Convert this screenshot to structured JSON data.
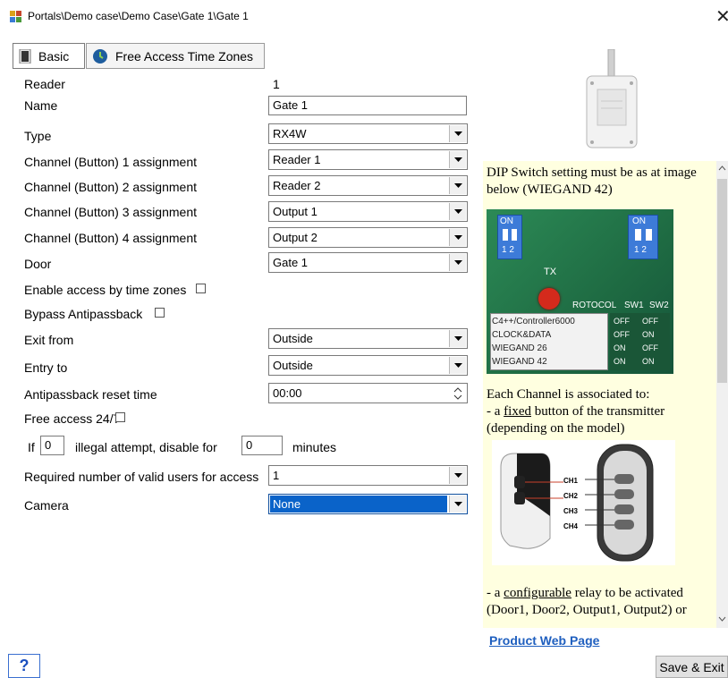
{
  "window": {
    "title": "Portals\\Demo case\\Demo Case\\Gate 1\\Gate 1",
    "close_glyph": "✕"
  },
  "tabs": [
    {
      "label": "Basic",
      "icon": "device-icon"
    },
    {
      "label": "Free Access Time Zones",
      "icon": "clock-icon"
    }
  ],
  "form": {
    "reader": {
      "label": "Reader",
      "value": "1"
    },
    "name": {
      "label": "Name",
      "value": "Gate 1"
    },
    "type": {
      "label": "Type",
      "value": "RX4W"
    },
    "ch1": {
      "label": "Channel (Button) 1 assignment",
      "value": "Reader 1"
    },
    "ch2": {
      "label": "Channel (Button) 2 assignment",
      "value": "Reader 2"
    },
    "ch3": {
      "label": "Channel (Button) 3 assignment",
      "value": "Output 1"
    },
    "ch4": {
      "label": "Channel (Button) 4 assignment",
      "value": "Output 2"
    },
    "door": {
      "label": "Door",
      "value": "Gate 1"
    },
    "enable_tz": {
      "label": "Enable access by time zones",
      "checked": false
    },
    "bypass": {
      "label": "Bypass Antipassback",
      "checked": false
    },
    "exit_from": {
      "label": "Exit from",
      "value": "Outside"
    },
    "entry_to": {
      "label": "Entry to",
      "value": "Outside"
    },
    "apb_reset": {
      "label": "Antipassback reset time",
      "value": "00:00"
    },
    "free_access": {
      "label": "Free access 24/7",
      "checked": false
    },
    "illegal": {
      "prefix": "If",
      "attempts": "0",
      "middle": "illegal attempt, disable for",
      "minutes": "0",
      "suffix": "minutes"
    },
    "required_users": {
      "label": "Required number of valid users for access",
      "value": "1"
    },
    "camera": {
      "label": "Camera",
      "value": "None"
    }
  },
  "info": {
    "dip_text": "DIP Switch setting must be as at image below (WIEGAND 42)",
    "dip_board": {
      "on1": "ON",
      "nums1": "1 2",
      "on2": "ON",
      "nums2": "1 2",
      "tx": "TX",
      "protocol": "ROTOCOL",
      "sw1": "SW1",
      "sw2": "SW2",
      "rows": [
        {
          "name": "C4++/Controller6000",
          "sw1": "OFF",
          "sw2": "OFF"
        },
        {
          "name": "CLOCK&DATA",
          "sw1": "OFF",
          "sw2": "ON"
        },
        {
          "name": "WIEGAND 26",
          "sw1": "ON",
          "sw2": "OFF"
        },
        {
          "name": "WIEGAND 42",
          "sw1": "ON",
          "sw2": "ON"
        }
      ]
    },
    "channel_intro": "Each Channel is associated to:",
    "fixed_pre": "- a ",
    "fixed_word": "fixed",
    "fixed_post": " button of the transmitter (depending on the model)",
    "ch_labels": [
      "CH1",
      "CH2",
      "CH3",
      "CH4"
    ],
    "config_pre": "- a ",
    "config_word": "configurable",
    "config_post": " relay to be activated (Door1, Door2, Output1, Output2) or"
  },
  "links": {
    "product_page": "Product Web Page"
  },
  "buttons": {
    "help": "?",
    "save_exit": "Save & Exit"
  },
  "colors": {
    "accent_selected": "#0a63c9",
    "info_background": "#ffffe0",
    "link": "#1f5fbf"
  }
}
